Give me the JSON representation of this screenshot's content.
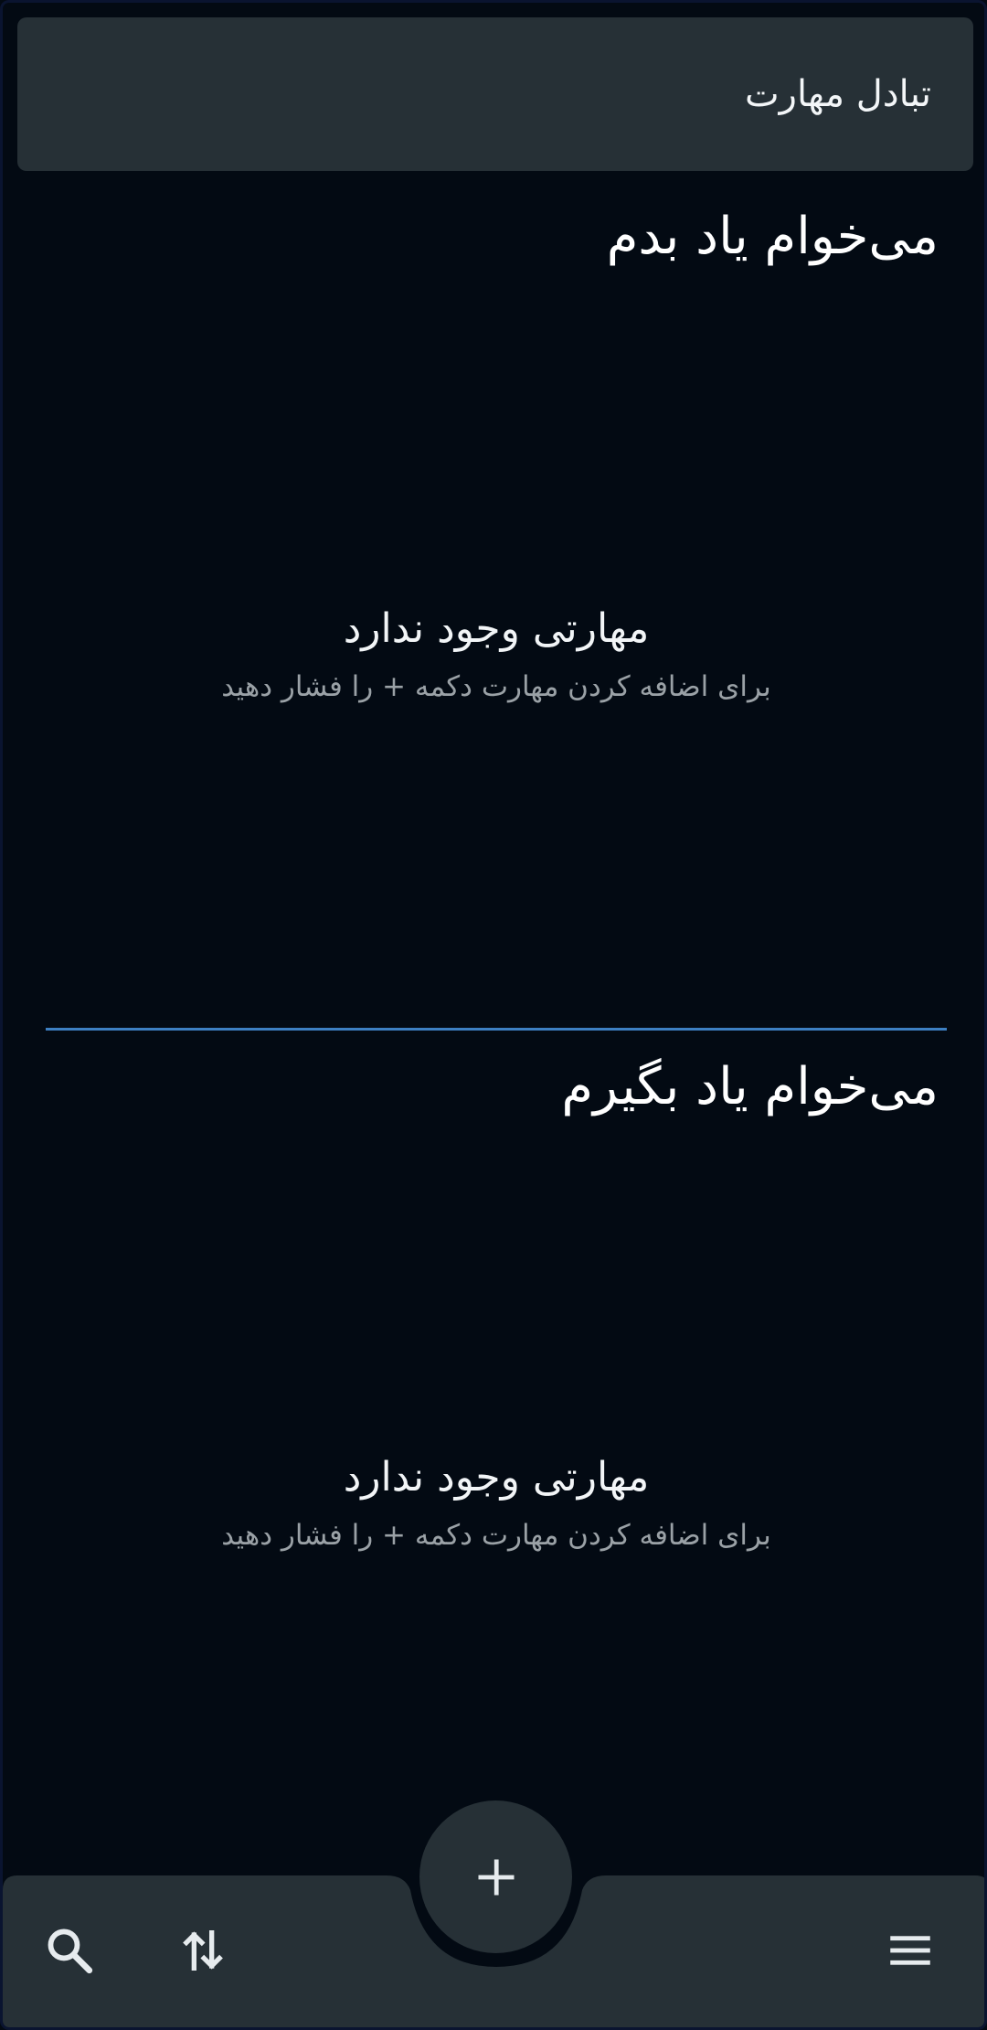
{
  "app": {
    "title": "تبادل مهارت"
  },
  "teach_section": {
    "title": "می‌خوام یاد بدم",
    "empty_title": "مهارتی وجود ندارد",
    "empty_hint": "برای اضافه کردن مهارت دکمه + را فشار دهید"
  },
  "learn_section": {
    "title": "می‌خوام یاد بگیرم",
    "empty_title": "مهارتی وجود ندارد",
    "empty_hint": "برای اضافه کردن مهارت دکمه + را فشار دهید"
  },
  "bottom_bar": {
    "left_icons": [
      "search-icon",
      "swap-vertical-icon"
    ],
    "right_icon": "menu-icon",
    "fab_icon": "plus-icon"
  },
  "colors": {
    "background": "#030a13",
    "surface": "#263036",
    "divider": "#3d7fc1",
    "text_primary": "#ffffff",
    "text_secondary": "#9aa1a6"
  }
}
